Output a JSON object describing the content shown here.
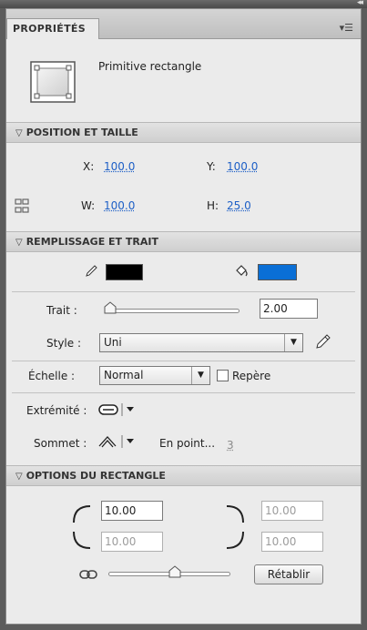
{
  "tab": {
    "label": "PROPRIÉTÉS"
  },
  "object": {
    "type_label": "Primitive rectangle"
  },
  "position": {
    "header": "POSITION ET TAILLE",
    "x_label": "X:",
    "x": "100.0",
    "y_label": "Y:",
    "y": "100.0",
    "w_label": "W:",
    "w": "100.0",
    "h_label": "H:",
    "h": "25.0"
  },
  "fill": {
    "header": "REMPLISSAGE ET TRAIT",
    "stroke_color": "#000000",
    "fill_color": "#0a6fd6",
    "stroke_label": "Trait :",
    "stroke_value": "2.00",
    "style_label": "Style :",
    "style_value": "Uni",
    "scale_label": "Échelle :",
    "scale_value": "Normal",
    "hinting_label": "Repère",
    "cap_label": "Extrémité :",
    "join_label": "Sommet :",
    "miter_label": "En point...",
    "miter_value": "3"
  },
  "rect_options": {
    "header": "OPTIONS DU RECTANGLE",
    "tl": "10.00",
    "tr": "10.00",
    "bl": "10.00",
    "br": "10.00",
    "reset_label": "Rétablir"
  }
}
